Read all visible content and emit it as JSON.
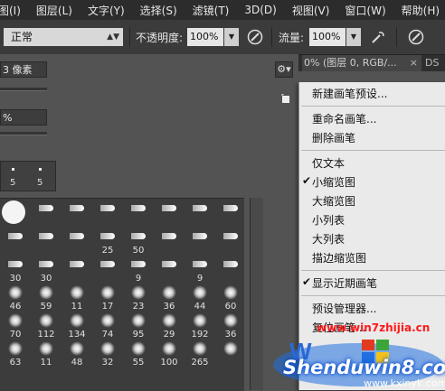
{
  "menu": [
    "图(I)",
    "图层(L)",
    "文字(Y)",
    "选择(S)",
    "滤镜(T)",
    "3D(D)",
    "视图(V)",
    "窗口(W)",
    "帮助(H)"
  ],
  "options": {
    "mode": "正常",
    "opacity_label": "不透明度:",
    "opacity": "100%",
    "flow_label": "流量:",
    "flow": "100%"
  },
  "doc_tab": {
    "title": "0% (图层 0, RGB/...",
    "close": "×",
    "next": "DS"
  },
  "panel": {
    "size": "3 像素",
    "hardness": "%",
    "recent": [
      "5",
      "5"
    ]
  },
  "brush_rows": [
    [
      "",
      "",
      "",
      "",
      "",
      "",
      "",
      ""
    ],
    [
      "",
      "",
      "",
      "25",
      "50",
      "",
      "",
      ""
    ],
    [
      "30",
      "30",
      "",
      "",
      "9",
      "",
      "9",
      ""
    ],
    [
      "46",
      "59",
      "11",
      "17",
      "23",
      "36",
      "44",
      "60"
    ],
    [
      "70",
      "112",
      "134",
      "74",
      "95",
      "29",
      "192",
      "36"
    ],
    [
      "63",
      "11",
      "48",
      "32",
      "55",
      "100",
      "265",
      ""
    ]
  ],
  "context_menu": {
    "groups": [
      [
        "新建画笔预设..."
      ],
      [
        "重命名画笔...",
        "删除画笔"
      ],
      [
        "仅文本",
        "小缩览图",
        "大缩览图",
        "小列表",
        "大列表",
        "描边缩览图"
      ],
      [
        "显示近期画笔"
      ],
      [
        "预设管理器...",
        "复位画笔..."
      ]
    ],
    "checked": [
      "小缩览图",
      "显示近期画笔"
    ]
  },
  "watermark": {
    "line1": "www.win7zhijia.cn",
    "line2": "Shenduwin8.com",
    "line3": "www.kxinyk.com"
  }
}
